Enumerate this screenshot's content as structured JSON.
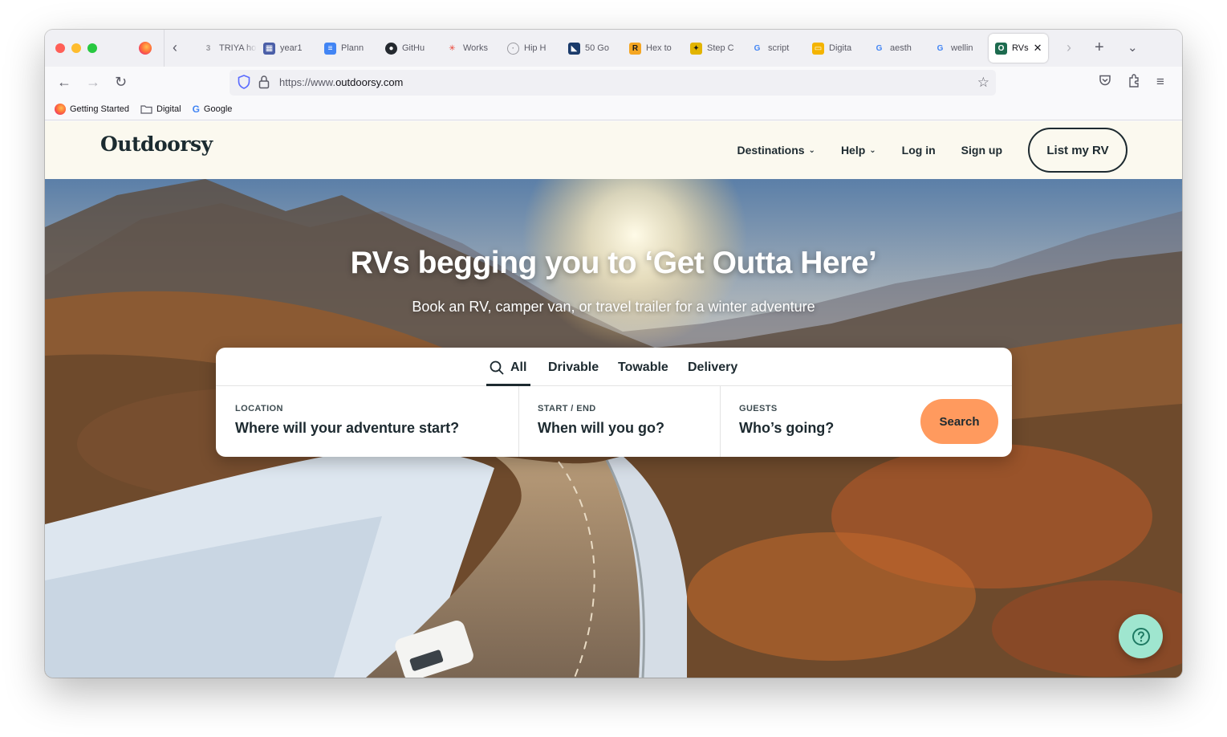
{
  "browser": {
    "tabs": [
      {
        "label": "TRIYA hon",
        "icon": "triya-icon",
        "color": "#9a9aa0"
      },
      {
        "label": "year1",
        "icon": "calendar-icon",
        "color": "#4b5fa8"
      },
      {
        "label": "Plann",
        "icon": "docs-icon",
        "color": "#4285f4"
      },
      {
        "label": "GitHu",
        "icon": "github-icon",
        "color": "#24292f"
      },
      {
        "label": "Works",
        "icon": "workspace-icon",
        "color": "#9aa0a6"
      },
      {
        "label": "Hip H",
        "icon": "globe-icon",
        "color": "#9a9aa0"
      },
      {
        "label": "50 Go",
        "icon": "image-icon",
        "color": "#1b3b6b"
      },
      {
        "label": "Hex to",
        "icon": "r-icon",
        "color": "#f5a623"
      },
      {
        "label": "Step C",
        "icon": "puzzle-icon",
        "color": "#e2b400"
      },
      {
        "label": "script",
        "icon": "google-icon",
        "color": "#4285f4"
      },
      {
        "label": "Digita",
        "icon": "slides-icon",
        "color": "#f4b400"
      },
      {
        "label": "aesth",
        "icon": "google-icon",
        "color": "#4285f4"
      },
      {
        "label": "wellin",
        "icon": "google-icon",
        "color": "#4285f4"
      },
      {
        "label": "RVs",
        "icon": "outdoorsy-icon",
        "color": "#1d6b4f",
        "active": true
      }
    ],
    "url": {
      "prefix": "https://www.",
      "domain": "outdoorsy.com"
    },
    "bookmarks": [
      {
        "label": "Getting Started",
        "icon": "firefox-icon"
      },
      {
        "label": "Digital",
        "icon": "folder-icon"
      },
      {
        "label": "Google",
        "icon": "google-icon"
      }
    ]
  },
  "site": {
    "logo": "Outdoorsy",
    "nav": {
      "destinations": "Destinations",
      "help": "Help",
      "login": "Log in",
      "signup": "Sign up",
      "list_rv": "List my RV"
    },
    "hero": {
      "title": "RVs begging you to ‘Get Outta Here’",
      "subtitle": "Book an RV, camper van, or travel trailer for a winter adventure"
    },
    "search": {
      "tabs": [
        "All",
        "Drivable",
        "Towable",
        "Delivery"
      ],
      "active_tab": "All",
      "location": {
        "label": "LOCATION",
        "placeholder": "Where will your adventure start?"
      },
      "dates": {
        "label": "START / END",
        "placeholder": "When will you go?"
      },
      "guests": {
        "label": "GUESTS",
        "placeholder": "Who’s going?"
      },
      "button": "Search"
    },
    "colors": {
      "header_bg": "#fbf9ef",
      "search_button": "#ff9a5e",
      "help_bubble": "#9fe6cf",
      "ink": "#1d2a30"
    }
  }
}
